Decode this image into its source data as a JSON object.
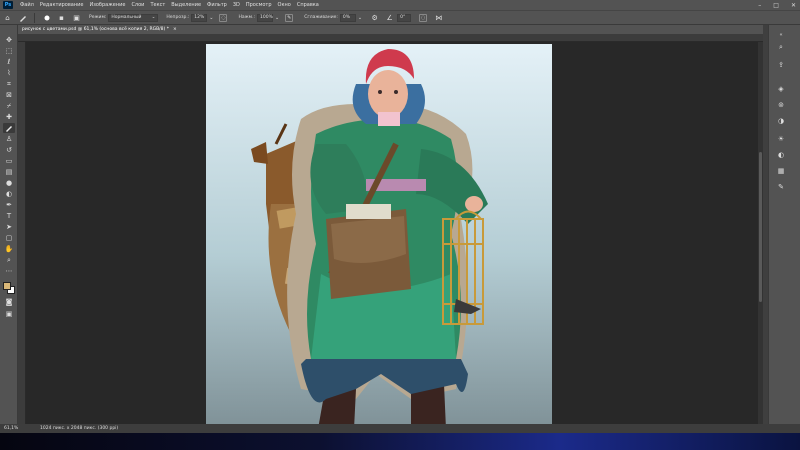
{
  "app": {
    "logo": "Ps",
    "menu": [
      "Файл",
      "Редактирование",
      "Изображение",
      "Слои",
      "Текст",
      "Выделение",
      "Фильтр",
      "3D",
      "Просмотр",
      "Окно",
      "Справка"
    ],
    "window_controls": {
      "minimize": "–",
      "maximize": "□",
      "close": "✕"
    }
  },
  "options": {
    "mode_label": "Режим:",
    "mode_value": "Нормальный",
    "opacity_label": "Непрозр.:",
    "opacity_value": "12%",
    "flow_label": "Нажм.:",
    "flow_value": "100%",
    "smoothing_label": "Сглаживание:",
    "smoothing_value": "0%",
    "angle_value": "0°"
  },
  "document": {
    "tab_title": "рисунок с цветами.psd @ 61,1% (основа всё копия 2, RGB/8) *",
    "close": "×"
  },
  "status": {
    "zoom": "61,1%",
    "info": "1024 пикс. x 2048 пикс. (300 ppi)"
  },
  "tools": [
    "move-icon",
    "marquee-icon",
    "lasso-icon",
    "quick-select-icon",
    "crop-icon",
    "frame-icon",
    "eyedropper-icon",
    "healing-icon",
    "brush-icon",
    "stamp-icon",
    "history-brush-icon",
    "eraser-icon",
    "gradient-icon",
    "blur-icon",
    "dodge-icon",
    "pen-icon",
    "type-icon",
    "path-select-icon",
    "shape-icon",
    "hand-icon",
    "zoom-icon",
    "more-icon"
  ],
  "colors": {
    "foreground": "#d9b778",
    "background": "#ffffff",
    "accent": "#31a8ff"
  }
}
